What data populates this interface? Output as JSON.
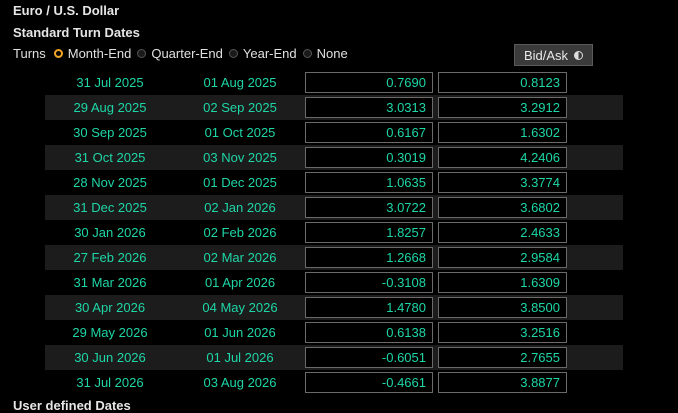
{
  "title": "Euro / U.S. Dollar",
  "subtitle": "Standard Turn Dates",
  "turns": {
    "label": "Turns",
    "options": [
      {
        "label": "Month-End",
        "checked": true
      },
      {
        "label": "Quarter-End",
        "checked": false
      },
      {
        "label": "Year-End",
        "checked": false
      },
      {
        "label": "None",
        "checked": false
      }
    ]
  },
  "bidask_label": "Bid/Ask",
  "rows": [
    {
      "start": "31 Jul 2025",
      "end": "01 Aug 2025",
      "bid": "0.7690",
      "ask": "0.8123"
    },
    {
      "start": "29 Aug 2025",
      "end": "02 Sep 2025",
      "bid": "3.0313",
      "ask": "3.2912"
    },
    {
      "start": "30 Sep 2025",
      "end": "01 Oct 2025",
      "bid": "0.6167",
      "ask": "1.6302"
    },
    {
      "start": "31 Oct 2025",
      "end": "03 Nov 2025",
      "bid": "0.3019",
      "ask": "4.2406"
    },
    {
      "start": "28 Nov 2025",
      "end": "01 Dec 2025",
      "bid": "1.0635",
      "ask": "3.3774"
    },
    {
      "start": "31 Dec 2025",
      "end": "02 Jan 2026",
      "bid": "3.0722",
      "ask": "3.6802"
    },
    {
      "start": "30 Jan 2026",
      "end": "02 Feb 2026",
      "bid": "1.8257",
      "ask": "2.4633"
    },
    {
      "start": "27 Feb 2026",
      "end": "02 Mar 2026",
      "bid": "1.2668",
      "ask": "2.9584"
    },
    {
      "start": "31 Mar 2026",
      "end": "01 Apr 2026",
      "bid": "-0.3108",
      "ask": "1.6309"
    },
    {
      "start": "30 Apr 2026",
      "end": "04 May 2026",
      "bid": "1.4780",
      "ask": "3.8500"
    },
    {
      "start": "29 May 2026",
      "end": "01 Jun 2026",
      "bid": "0.6138",
      "ask": "3.2516"
    },
    {
      "start": "30 Jun 2026",
      "end": "01 Jul 2026",
      "bid": "-0.6051",
      "ask": "2.7655"
    },
    {
      "start": "31 Jul 2026",
      "end": "03 Aug 2026",
      "bid": "-0.4661",
      "ask": "3.8877"
    }
  ],
  "footer_label": "User defined Dates",
  "colors": {
    "accent": "#1ed6a6",
    "radio_selected": "#f5a623",
    "background": "#000000"
  }
}
